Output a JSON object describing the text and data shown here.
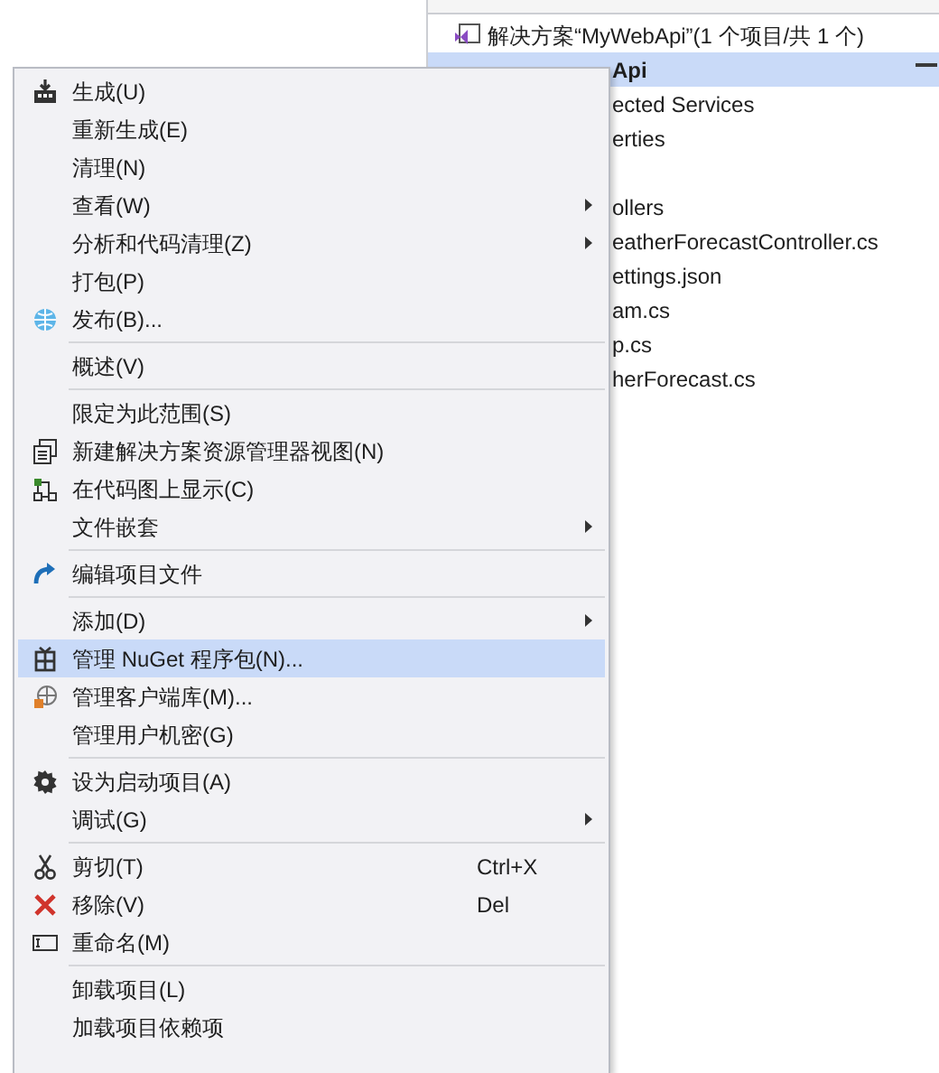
{
  "solution_explorer": {
    "rows": [
      {
        "kind": "solution",
        "label": "解决方案“MyWebApi”(1 个项目/共 1 个)",
        "selected": false
      },
      {
        "kind": "project",
        "label": "Api",
        "selected": true
      },
      {
        "kind": "item",
        "label": "ected Services",
        "selected": false
      },
      {
        "kind": "item",
        "label": "erties",
        "selected": false
      },
      {
        "kind": "covered"
      },
      {
        "kind": "item",
        "label": "ollers",
        "selected": false
      },
      {
        "kind": "item",
        "label": "eatherForecastController.cs",
        "selected": false
      },
      {
        "kind": "item",
        "label": "ettings.json",
        "selected": false
      },
      {
        "kind": "item",
        "label": "am.cs",
        "selected": false
      },
      {
        "kind": "item",
        "label": "p.cs",
        "selected": false
      },
      {
        "kind": "item",
        "label": "herForecast.cs",
        "selected": false
      }
    ]
  },
  "context_menu": [
    {
      "kind": "item",
      "label": "生成(U)",
      "submenu": false,
      "selected": false
    },
    {
      "kind": "item",
      "label": "重新生成(E)",
      "submenu": false,
      "selected": false
    },
    {
      "kind": "item",
      "label": "清理(N)",
      "submenu": false,
      "selected": false
    },
    {
      "kind": "item",
      "label": "查看(W)",
      "submenu": true,
      "selected": false
    },
    {
      "kind": "item",
      "label": "分析和代码清理(Z)",
      "submenu": true,
      "selected": false
    },
    {
      "kind": "item",
      "label": "打包(P)",
      "submenu": false,
      "selected": false
    },
    {
      "kind": "item",
      "label": "发布(B)...",
      "submenu": false,
      "selected": false
    },
    {
      "kind": "separator"
    },
    {
      "kind": "item",
      "label": "概述(V)",
      "submenu": false,
      "selected": false
    },
    {
      "kind": "separator"
    },
    {
      "kind": "item",
      "label": "限定为此范围(S)",
      "submenu": false,
      "selected": false
    },
    {
      "kind": "item",
      "label": "新建解决方案资源管理器视图(N)",
      "submenu": false,
      "selected": false
    },
    {
      "kind": "item",
      "label": "在代码图上显示(C)",
      "submenu": false,
      "selected": false
    },
    {
      "kind": "item",
      "label": "文件嵌套",
      "submenu": true,
      "selected": false
    },
    {
      "kind": "separator"
    },
    {
      "kind": "item",
      "label": "编辑项目文件",
      "submenu": false,
      "selected": false
    },
    {
      "kind": "separator"
    },
    {
      "kind": "item",
      "label": "添加(D)",
      "submenu": true,
      "selected": false
    },
    {
      "kind": "item",
      "label": "管理 NuGet 程序包(N)...",
      "submenu": false,
      "selected": true
    },
    {
      "kind": "item",
      "label": "管理客户端库(M)...",
      "submenu": false,
      "selected": false
    },
    {
      "kind": "item",
      "label": "管理用户机密(G)",
      "submenu": false,
      "selected": false
    },
    {
      "kind": "separator"
    },
    {
      "kind": "item",
      "label": "设为启动项目(A)",
      "submenu": false,
      "selected": false
    },
    {
      "kind": "item",
      "label": "调试(G)",
      "submenu": true,
      "selected": false
    },
    {
      "kind": "separator"
    },
    {
      "kind": "item",
      "label": "剪切(T)",
      "shortcut": "Ctrl+X",
      "submenu": false,
      "selected": false
    },
    {
      "kind": "item",
      "label": "移除(V)",
      "shortcut": "Del",
      "submenu": false,
      "selected": false
    },
    {
      "kind": "item",
      "label": "重命名(M)",
      "submenu": false,
      "selected": false
    },
    {
      "kind": "separator"
    },
    {
      "kind": "item",
      "label": "卸载项目(L)",
      "submenu": false,
      "selected": false
    },
    {
      "kind": "item",
      "label": "加载项目依赖项",
      "submenu": false,
      "selected": false
    }
  ]
}
